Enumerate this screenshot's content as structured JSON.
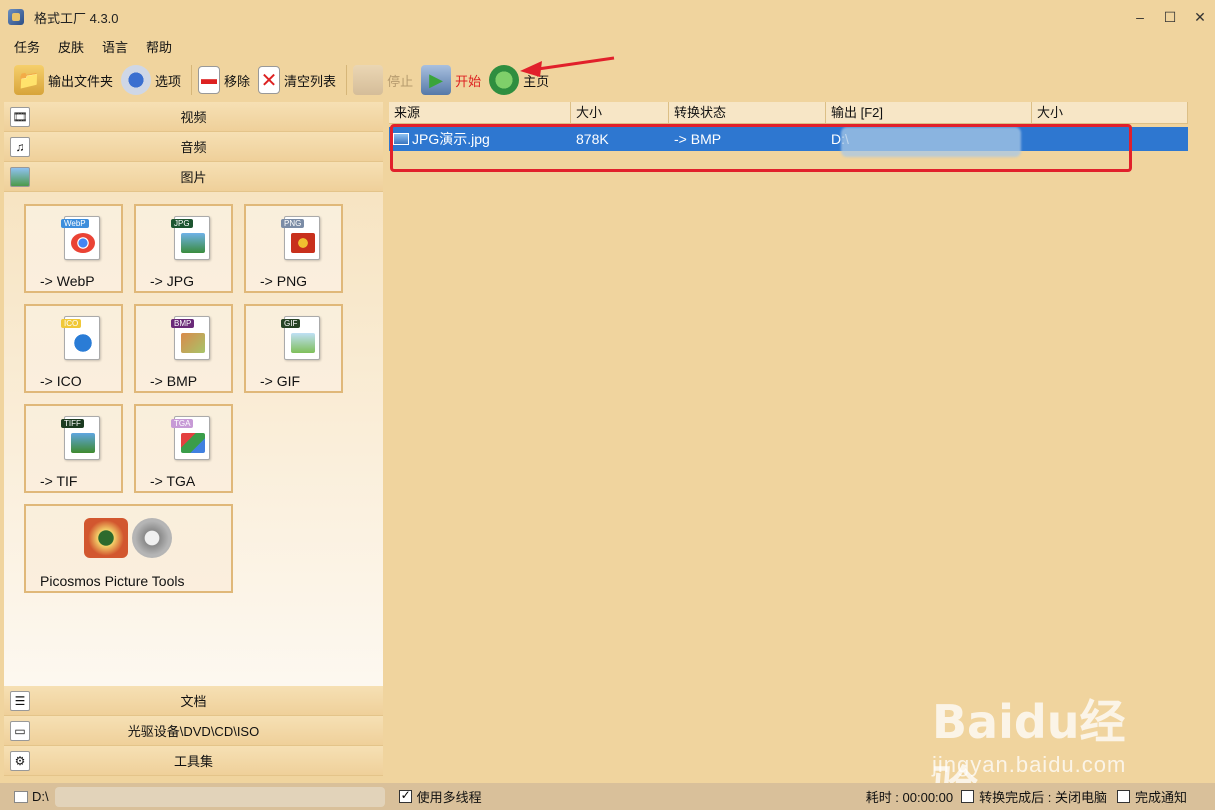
{
  "window": {
    "title": "格式工厂 4.3.0",
    "buttons": [
      "–",
      "☐",
      "✕"
    ]
  },
  "menu": [
    "任务",
    "皮肤",
    "语言",
    "帮助"
  ],
  "toolbar": {
    "output_folder": "输出文件夹",
    "options": "选项",
    "remove": "移除",
    "clear_list": "清空列表",
    "stop": "停止",
    "start": "开始",
    "home": "主页"
  },
  "sidebar": {
    "video": "视频",
    "audio": "音频",
    "picture": "图片",
    "document": "文档",
    "disc": "光驱设备\\DVD\\CD\\ISO",
    "tools": "工具集"
  },
  "picture_tiles": [
    {
      "label": "-> WebP",
      "tag": "WebP",
      "tag_color": "#3d8edc"
    },
    {
      "label": "-> JPG",
      "tag": "JPG",
      "tag_color": "#1d5530"
    },
    {
      "label": "-> PNG",
      "tag": "PNG",
      "tag_color": "#7b8ca6"
    },
    {
      "label": "-> ICO",
      "tag": "ICO",
      "tag_color": "#f0c838"
    },
    {
      "label": "-> BMP",
      "tag": "BMP",
      "tag_color": "#6a2a78"
    },
    {
      "label": "-> GIF",
      "tag": "GIF",
      "tag_color": "#264224"
    },
    {
      "label": "-> TIF",
      "tag": "TIFF",
      "tag_color": "#1b3a20"
    },
    {
      "label": "-> TGA",
      "tag": "TGA",
      "tag_color": "#c79ad6"
    },
    {
      "label": "Picosmos Picture Tools"
    }
  ],
  "table": {
    "headers": [
      "来源",
      "大小",
      "转换状态",
      "输出 [F2]",
      "大小"
    ],
    "rows": [
      {
        "source": "JPG演示.jpg",
        "size": "878K",
        "status": "-> BMP",
        "output": "D:\\",
        "out_size": ""
      }
    ]
  },
  "status": {
    "path": "D:\\",
    "multithread": "使用多线程",
    "elapsed": "耗时 : 00:00:00",
    "after_convert": "转换完成后 : 关闭电脑",
    "notify": "完成通知"
  },
  "watermark": {
    "main": "Baidu经验",
    "sub": "jingyan.baidu.com"
  },
  "colors": {
    "background": "#f0d49e",
    "selection": "#2e77d0",
    "highlight": "#e1202b"
  }
}
